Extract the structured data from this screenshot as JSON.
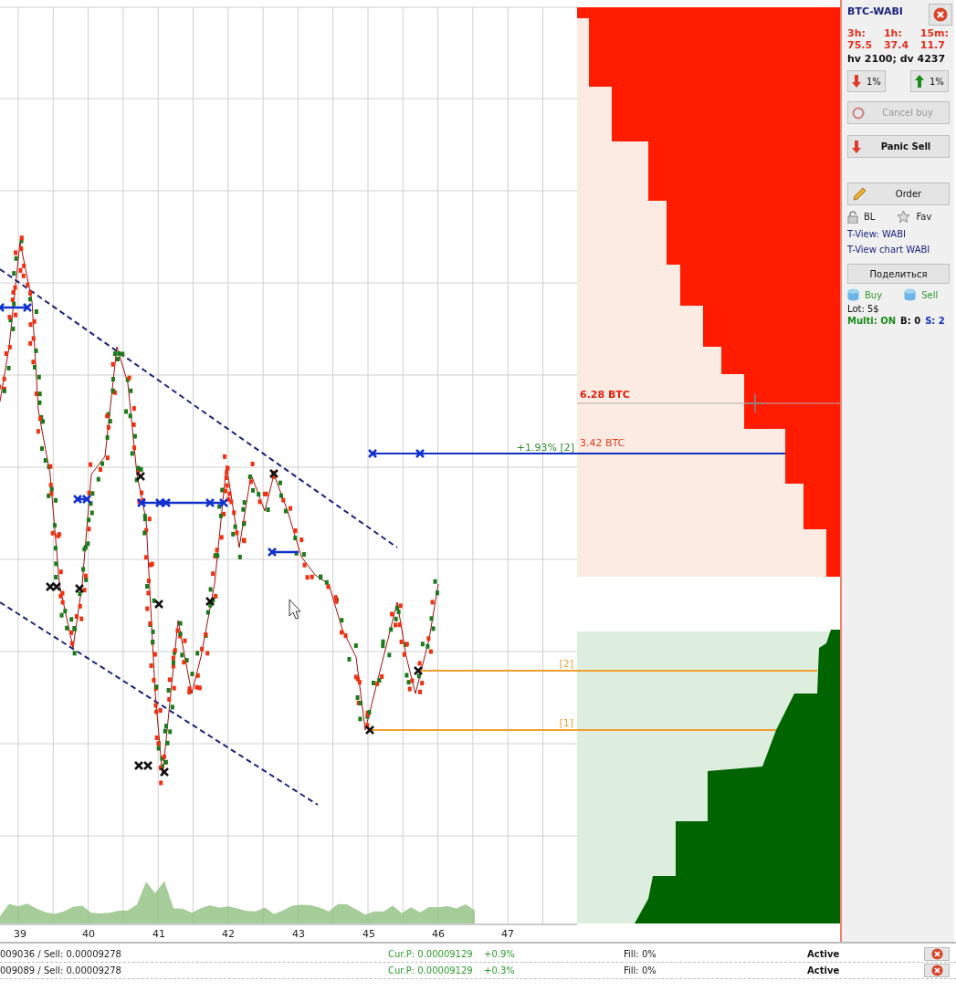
{
  "chart": {
    "axis_labels": [
      "39",
      "40",
      "41",
      "42",
      "43",
      "45",
      "46",
      "47"
    ],
    "ask_volume": "6.28 BTC",
    "sell_line": {
      "profit": "+1.93%",
      "index": "[2]",
      "volume": "3.42 BTC"
    },
    "buy_lines": [
      {
        "index": "[2]"
      },
      {
        "index": "[1]"
      }
    ]
  },
  "panel": {
    "symbol": "BTC-WABI",
    "volatility": [
      {
        "label": "3h:",
        "value": "75.5"
      },
      {
        "label": "1h:",
        "value": "37.4"
      },
      {
        "label": "15m:",
        "value": "11.7"
      }
    ],
    "hv_dv": "hv 2100; dv 4237",
    "step_buttons": [
      {
        "kind": "down",
        "label": "1%"
      },
      {
        "kind": "up",
        "label": "1%"
      }
    ],
    "cancel_button": {
      "label": "Cancel buy",
      "disabled": true
    },
    "panic_button": {
      "label": "Panic Sell"
    },
    "order_button": {
      "label": "Order"
    },
    "bl": "BL",
    "fav": "Fav",
    "links": [
      "T-View: WABI",
      "T-View chart WABI"
    ],
    "share_button": "Поделиться",
    "buy": "Buy",
    "sell": "Sell",
    "lot": "Lot: 5$",
    "multi": {
      "label": "Multi: ON",
      "on": true
    },
    "b_count": "B: 0",
    "s_count": "S: 2"
  },
  "orders": [
    {
      "prices": "009036 / Sell: 0.00009278",
      "current": "Cur.P: 0.00009129",
      "change": "+0.9%",
      "fill": "Fill: 0%",
      "status": "Active"
    },
    {
      "prices": "009089 / Sell: 0.00009278",
      "current": "Cur.P: 0.00009129",
      "change": "+0.3%",
      "fill": "Fill: 0%",
      "status": "Active"
    }
  ]
}
